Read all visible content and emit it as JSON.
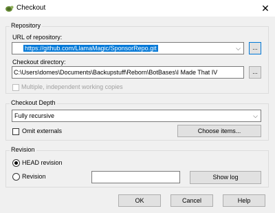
{
  "window": {
    "title": "Checkout",
    "close_glyph": "✕"
  },
  "repository": {
    "group_label": "Repository",
    "url_label": "URL of repository:",
    "url_value": "https://github.com/LlamaMagic/SponsorRepo.git",
    "browse_label": "...",
    "dir_label": "Checkout directory:",
    "dir_value": "C:\\Users\\domes\\Documents\\Backupstuff\\Reborn\\BotBases\\I Made That IV",
    "multiple_label": "Multiple, independent working copies"
  },
  "depth": {
    "group_label": "Checkout Depth",
    "selected": "Fully recursive",
    "omit_label": "Omit externals",
    "choose_label": "Choose items..."
  },
  "revision": {
    "group_label": "Revision",
    "head_label": "HEAD revision",
    "revision_label": "Revision",
    "revision_value": "",
    "show_log_label": "Show log"
  },
  "footer": {
    "ok": "OK",
    "cancel": "Cancel",
    "help": "Help"
  },
  "icons": {
    "app": "tortoise-icon",
    "dropdown": "chevron-down-icon"
  }
}
